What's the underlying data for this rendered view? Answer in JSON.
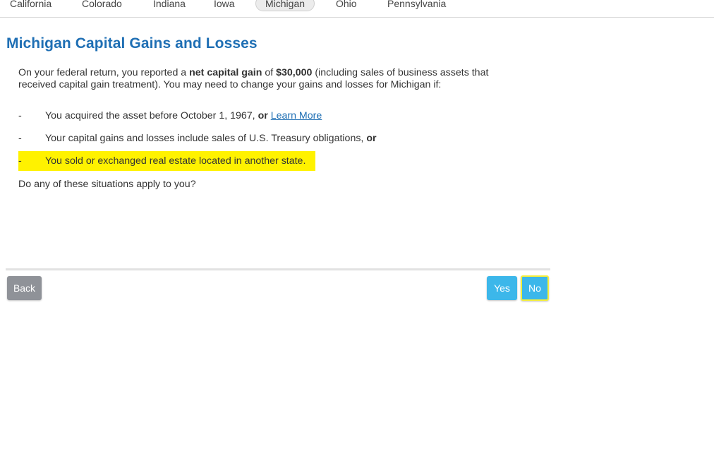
{
  "state_tabs": [
    {
      "label": "California",
      "active": false
    },
    {
      "label": "Colorado",
      "active": false
    },
    {
      "label": "Indiana",
      "active": false
    },
    {
      "label": "Iowa",
      "active": false
    },
    {
      "label": "Michigan",
      "active": true
    },
    {
      "label": "Ohio",
      "active": false
    },
    {
      "label": "Pennsylvania",
      "active": false
    }
  ],
  "page_title": "Michigan Capital Gains and Losses",
  "intro": {
    "part1": "On your federal return, you reported a ",
    "bold1": "net capital gain",
    "part2": " of ",
    "bold2": "$30,000",
    "part3": " (including sales of business assets that received capital gain treatment). You may need to change your gains and losses for Michigan if:"
  },
  "conditions": [
    {
      "dash": "-",
      "text": "You acquired the asset before October 1, 1967, ",
      "bold": "or",
      "link": "Learn More"
    },
    {
      "dash": "-",
      "text": "Your capital gains and losses include sales of U.S. Treasury obligations, ",
      "bold": "or"
    },
    {
      "dash": "-",
      "text": "You sold or exchanged real estate located in another state."
    }
  ],
  "question": "Do any of these situations apply to you?",
  "buttons": {
    "back": "Back",
    "yes": "Yes",
    "no": "No"
  },
  "colors": {
    "title": "#1f6fb4",
    "highlight": "#fff200",
    "primary_button": "#3cb7ea",
    "back_button": "#8f9298"
  }
}
